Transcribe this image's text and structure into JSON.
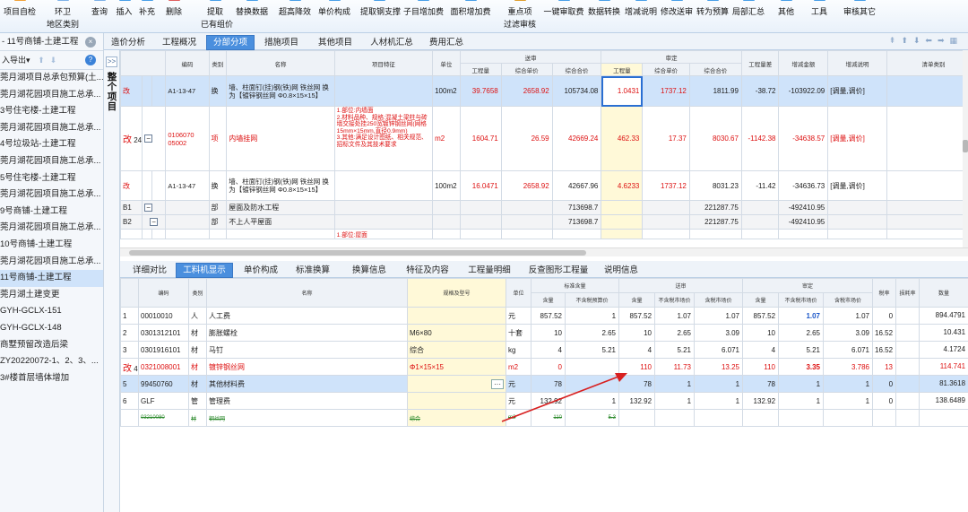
{
  "toolbar": [
    {
      "l1": "项目自检",
      "l2": "",
      "c": "#f2a33a"
    },
    {
      "l1": "环卫",
      "l2": "地区类别",
      "c": "#7fb2e8"
    },
    {
      "l1": "查询",
      "l2": "",
      "c": "#7fb2e8"
    },
    {
      "l1": "插入",
      "l2": "",
      "c": "#4aa0e8"
    },
    {
      "l1": "补充",
      "l2": "",
      "c": "#4aa0e8"
    },
    {
      "l1": "删除",
      "l2": "",
      "c": "#e06060"
    },
    {
      "l1": "提取",
      "l2": "已有组价",
      "c": "#4aa0e8"
    },
    {
      "l1": "替换数据",
      "l2": "",
      "c": "#4aa0e8"
    },
    {
      "l1": "超高降效",
      "l2": "",
      "c": "#4aa0e8"
    },
    {
      "l1": "单价构成",
      "l2": "",
      "c": "#4aa0e8"
    },
    {
      "l1": "提取钢支撑",
      "l2": "",
      "c": "#4aa0e8"
    },
    {
      "l1": "子目增加费",
      "l2": "",
      "c": "#4aa0e8"
    },
    {
      "l1": "面积增加费",
      "l2": "",
      "c": "#4aa0e8"
    },
    {
      "l1": "重点项",
      "l2": "过滤审核",
      "c": "#e0a030"
    },
    {
      "l1": "一键审取费",
      "l2": "",
      "c": "#4aa0e8"
    },
    {
      "l1": "数据转换",
      "l2": "",
      "c": "#4aa0e8"
    },
    {
      "l1": "增减说明",
      "l2": "",
      "c": "#4aa0e8"
    },
    {
      "l1": "修改送审",
      "l2": "",
      "c": "#4aa0e8"
    },
    {
      "l1": "转为预算",
      "l2": "",
      "c": "#4aa0e8"
    },
    {
      "l1": "局部汇总",
      "l2": "",
      "c": "#4aa0e8"
    },
    {
      "l1": "其他",
      "l2": "",
      "c": "#4aa0e8"
    },
    {
      "l1": "工具",
      "l2": "",
      "c": "#4aa0e8"
    },
    {
      "l1": "审核其它",
      "l2": "",
      "c": "#4aa0e8"
    }
  ],
  "sidebar": {
    "project": "- 11号商铺-土建工程",
    "export": "入导出",
    "items": [
      "莞月湖项目总承包预算(土...",
      "莞月湖花园项目施工总承...",
      "3号住宅楼-土建工程",
      "莞月湖花园项目施工总承...",
      "4号垃圾站-土建工程",
      "莞月湖花园项目施工总承...",
      "5号住宅楼-土建工程",
      "莞月湖花园项目施工总承...",
      "9号商铺-土建工程",
      "莞月湖花园项目施工总承...",
      "10号商铺-土建工程",
      "莞月湖花园项目施工总承...",
      "11号商铺-土建工程",
      "莞月湖土建变更",
      "GYH-GCLX-151",
      "GYH-GCLX-148",
      "商墅预留改造后梁",
      "ZY20220072-1、2、3、...",
      "3#楼首层墙体增加"
    ],
    "selected": 12
  },
  "vstrip": {
    "expand": ">>",
    "label": "整个项目"
  },
  "tabs": [
    "造价分析",
    "工程概况",
    "分部分项",
    "措施项目",
    "其他项目",
    "人材机汇总",
    "费用汇总"
  ],
  "active_tab": 2,
  "upper": {
    "headers": {
      "code": "编码",
      "type": "类别",
      "name": "名称",
      "feature": "项目特征",
      "unit": "单位",
      "sent": "送审",
      "approved": "审定",
      "qty": "工程量",
      "uprice": "综合单价",
      "total": "综合合价",
      "diffqty": "工程量差",
      "diffamt": "增减金额",
      "diffnote": "增减说明",
      "diffitem": "清单类别"
    },
    "rows": [
      {
        "mark": "改",
        "code": "A1-13-47",
        "type": "换",
        "name": "墙、柱面钉(挂)钢(铁)网 铁丝网  换为【镀锌钢丝网 Φ0.8×15×15】",
        "feature": "",
        "unit": "100m2",
        "s_qty": "39.7658",
        "s_price": "2658.92",
        "s_total": "105734.08",
        "a_qty": "1.0431",
        "a_price": "1737.12",
        "a_total": "1811.99",
        "d_qty": "-38.72",
        "d_amt": "-103922.09",
        "d_note": "[调量,调价]"
      },
      {
        "mark": "改",
        "no": "24",
        "code": "0106070 05002",
        "type": "项",
        "name": "内墙挂网",
        "feature": "1.部位:内墙面\n2.材料品种、规格:混凝土梁柱与砖墙交接处挂250宽镀锌钢丝网(网格15mm×15mm,直径0.9mm)\n3.其他:满足设计图纸、相关规范、招标文件及其技术要求",
        "unit": "m2",
        "s_qty": "1604.71",
        "s_price": "26.59",
        "s_total": "42669.24",
        "a_qty": "462.33",
        "a_price": "17.37",
        "a_total": "8030.67",
        "d_qty": "-1142.38",
        "d_amt": "-34638.57",
        "d_note": "[调量,调价]"
      },
      {
        "mark": "改",
        "code": "A1-13-47",
        "type": "换",
        "name": "墙、柱面钉(挂)钢(铁)网 铁丝网  换为【镀锌钢丝网 Φ0.8×15×15】",
        "feature": "",
        "unit": "100m2",
        "s_qty": "16.0471",
        "s_price": "2658.92",
        "s_total": "42667.96",
        "a_qty": "4.6233",
        "a_price": "1737.12",
        "a_total": "8031.23",
        "d_qty": "-11.42",
        "d_amt": "-34636.73",
        "d_note": "[调量,调价]"
      },
      {
        "mark": "B1",
        "type": "部",
        "name": "屋面及防水工程",
        "s_total": "713698.7",
        "a_total": "221287.75",
        "d_amt": "-492410.95"
      },
      {
        "mark": "B2",
        "type": "部",
        "name": "不上人平屋面",
        "s_total": "713698.7",
        "a_total": "221287.75",
        "d_amt": "-492410.95"
      },
      {
        "feature": "1.部位:屋面"
      }
    ]
  },
  "bottom_tabs": [
    "详细对比",
    "工料机显示",
    "单价构成",
    "标准换算",
    "换算信息",
    "特征及内容",
    "工程量明细",
    "反查图形工程量",
    "说明信息"
  ],
  "active_bottom_tab": 1,
  "lower": {
    "headers": {
      "code": "编码",
      "type": "类别",
      "name": "名称",
      "spec": "规格及型号",
      "unit": "单位",
      "ref": "标准含量",
      "ref_qty": "含量",
      "ref_price": "不含税预算价",
      "sent": "送审",
      "s_qty": "含量",
      "s_price": "不含税市场价",
      "s_tax": "含税市场价",
      "approved": "审定",
      "a_qty": "含量",
      "a_price": "不含税市场价",
      "a_tax": "含税市场价",
      "taxrate": "税率",
      "lossrate": "损耗率",
      "amount": "数量"
    },
    "rows": [
      {
        "no": "1",
        "code": "00010010",
        "type": "人",
        "name": "人工费",
        "spec": "",
        "unit": "元",
        "r_qty": "857.52",
        "r_price": "1",
        "s_qty": "857.52",
        "s_price": "1.07",
        "s_tax": "1.07",
        "a_qty": "857.52",
        "a_price": "1.07",
        "a_tax": "1.07",
        "tax": "0",
        "loss": "",
        "amt": "894.4791"
      },
      {
        "no": "2",
        "code": "0301312101",
        "type": "材",
        "name": "膨胀螺栓",
        "spec": "M6×80",
        "unit": "十套",
        "r_qty": "10",
        "r_price": "2.65",
        "s_qty": "10",
        "s_price": "2.65",
        "s_tax": "3.09",
        "a_qty": "10",
        "a_price": "2.65",
        "a_tax": "3.09",
        "tax": "16.52",
        "loss": "",
        "amt": "10.431"
      },
      {
        "no": "3",
        "code": "0301916101",
        "type": "材",
        "name": "马钉",
        "spec": "综合",
        "unit": "kg",
        "r_qty": "4",
        "r_price": "5.21",
        "s_qty": "4",
        "s_price": "5.21",
        "s_tax": "6.071",
        "a_qty": "4",
        "a_price": "5.21",
        "a_tax": "6.071",
        "tax": "16.52",
        "loss": "",
        "amt": "4.1724"
      },
      {
        "mark": "改",
        "no": "4",
        "code": "0321008001",
        "type": "材",
        "name": "镀锌钢丝网",
        "spec": "Φ1×15×15",
        "unit": "m2",
        "r_qty": "0",
        "r_price": "",
        "s_qty": "110",
        "s_price": "11.73",
        "s_tax": "13.25",
        "a_qty": "110",
        "a_price": "3.35",
        "a_tax": "3.786",
        "tax": "13",
        "loss": "",
        "amt": "114.741"
      },
      {
        "no": "5",
        "code": "99450760",
        "type": "材",
        "name": "其他材料费",
        "spec": "",
        "unit": "元",
        "r_qty": "78",
        "r_price": "",
        "s_qty": "78",
        "s_price": "1",
        "s_tax": "1",
        "a_qty": "78",
        "a_price": "1",
        "a_tax": "1",
        "tax": "0",
        "loss": "",
        "amt": "81.3618"
      },
      {
        "no": "6",
        "code": "GLF",
        "type": "管",
        "name": "管理费",
        "spec": "",
        "unit": "元",
        "r_qty": "132.92",
        "r_price": "1",
        "s_qty": "132.92",
        "s_price": "1",
        "s_tax": "1",
        "a_qty": "132.92",
        "a_price": "1",
        "a_tax": "1",
        "tax": "0",
        "loss": "",
        "amt": "138.6489"
      },
      {
        "no": "",
        "code": "03210080",
        "type": "材",
        "name": "钢丝网",
        "spec": "综合",
        "unit": "m2",
        "r_qty": "110",
        "r_price": "5.3",
        "s_qty": "",
        "s_price": "",
        "s_tax": "",
        "a_qty": "",
        "a_price": "",
        "a_tax": "",
        "tax": "",
        "loss": "",
        "amt": ""
      }
    ]
  },
  "colors": {
    "accent": "#4a8fde",
    "selected_row": "#cfe3fa",
    "changed_text": "#d11111",
    "arrow": "#d82020"
  }
}
